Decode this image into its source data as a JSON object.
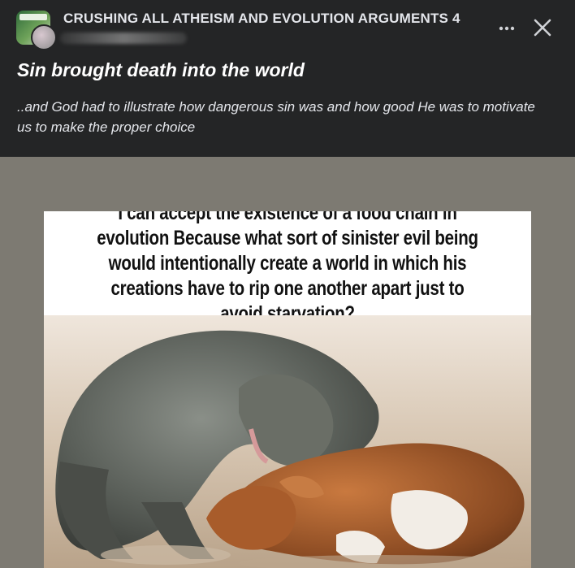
{
  "post": {
    "group_name": "CRUSHING ALL ATHEISM AND EVOLUTION ARGUMENTS 4",
    "title": "Sin brought death into the world",
    "body": "..and God had to illustrate how dangerous sin was and how good He was to motivate us to make the proper choice",
    "more_icon": "more-icon",
    "close_icon": "close-icon"
  },
  "meme": {
    "caption": "I can accept the existence of a food chain in evolution Because what sort of sinister evil being would intentionally create a world in which his creations have to rip one another apart just to avoid starvation?"
  },
  "colors": {
    "background": "#242526",
    "text_primary": "#ffffff",
    "text_secondary": "#e4e6eb",
    "media_background": "#7d7a72"
  }
}
